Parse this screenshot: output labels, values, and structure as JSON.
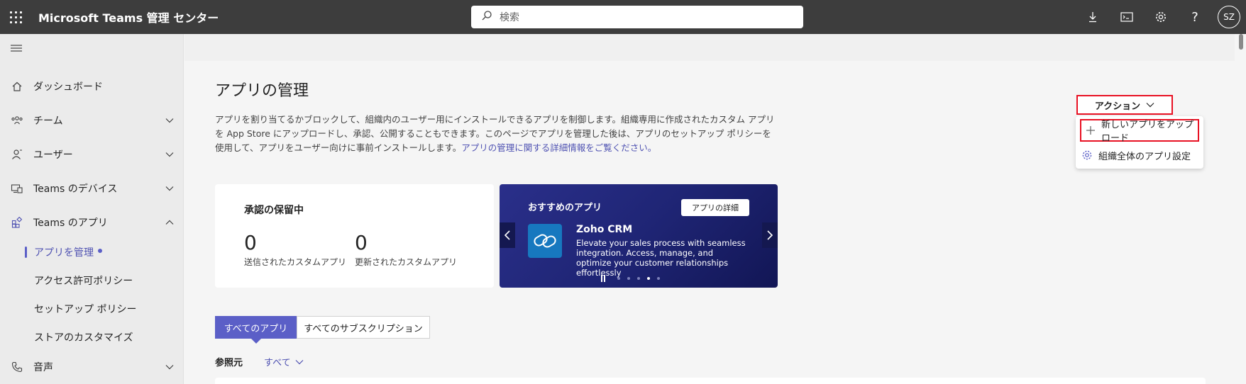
{
  "app": {
    "title": "Microsoft Teams 管理 センター"
  },
  "search": {
    "placeholder": "検索"
  },
  "header_icons": [
    "download-icon",
    "console-icon",
    "gear-icon",
    "help-icon"
  ],
  "user": {
    "initials": "SZ"
  },
  "sidebar": {
    "items": [
      {
        "label": "ダッシュボード",
        "icon": "home-icon"
      },
      {
        "label": "チーム",
        "icon": "teams-icon",
        "expandable": true
      },
      {
        "label": "ユーザー",
        "icon": "user-icon",
        "expandable": true
      },
      {
        "label": "Teams のデバイス",
        "icon": "device-icon",
        "expandable": true
      },
      {
        "label": "Teams のアプリ",
        "icon": "apps-icon",
        "expanded": true
      },
      {
        "label": "音声",
        "icon": "phone-icon",
        "expandable": true
      }
    ],
    "sub_items": [
      {
        "label": "アプリを管理",
        "active": true
      },
      {
        "label": "アクセス許可ポリシー"
      },
      {
        "label": "セットアップ ポリシー"
      },
      {
        "label": "ストアのカスタマイズ"
      }
    ]
  },
  "page": {
    "title": "アプリの管理",
    "description": "アプリを割り当てるかブロックして、組織内のユーザー用にインストールできるアプリを制御します。組織専用に作成されたカスタム アプリを App Store にアップロードし、承認、公開することもできます。このページでアプリを管理した後は、アプリのセットアップ ポリシーを使用して、アプリをユーザー向けに事前インストールします。",
    "learn_more": "アプリの管理に関する詳細情報をご覧ください。"
  },
  "actions": {
    "label": "アクション",
    "menu": [
      {
        "label": "新しいアプリをアップロード",
        "icon": "plus-icon"
      },
      {
        "label": "組織全体のアプリ設定",
        "icon": "gear-icon"
      }
    ]
  },
  "pending": {
    "title": "承認の保留中",
    "stats": [
      {
        "value": "0",
        "label": "送信されたカスタムアプリ"
      },
      {
        "value": "0",
        "label": "更新されたカスタムアプリ"
      }
    ]
  },
  "featured": {
    "label": "おすすめのアプリ",
    "details_button": "アプリの詳細",
    "app_name": "Zoho CRM",
    "app_desc": "Elevate your sales process with seamless integration. Access, manage, and optimize your customer relationships effortlessly",
    "dots": 5,
    "active_dot": 4
  },
  "tabs": [
    {
      "label": "すべてのアプリ",
      "active": true
    },
    {
      "label": "すべてのサブスクリプション"
    }
  ],
  "filter": {
    "label": "参照元",
    "value": "すべて"
  },
  "colors": {
    "accent": "#5b5fc7",
    "topbar": "#3d3d3d",
    "highlight": "#e81123",
    "featured_bg": "#1f2575"
  }
}
